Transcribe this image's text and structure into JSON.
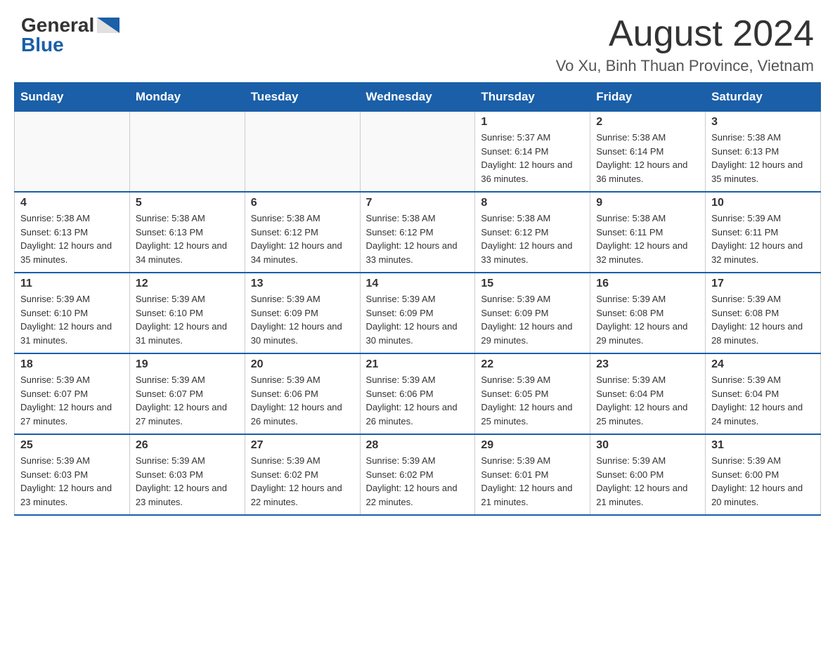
{
  "header": {
    "logo_general": "General",
    "logo_blue": "Blue",
    "title": "August 2024",
    "location": "Vo Xu, Binh Thuan Province, Vietnam"
  },
  "weekdays": [
    "Sunday",
    "Monday",
    "Tuesday",
    "Wednesday",
    "Thursday",
    "Friday",
    "Saturday"
  ],
  "weeks": [
    [
      {
        "day": "",
        "info": ""
      },
      {
        "day": "",
        "info": ""
      },
      {
        "day": "",
        "info": ""
      },
      {
        "day": "",
        "info": ""
      },
      {
        "day": "1",
        "info": "Sunrise: 5:37 AM\nSunset: 6:14 PM\nDaylight: 12 hours and 36 minutes."
      },
      {
        "day": "2",
        "info": "Sunrise: 5:38 AM\nSunset: 6:14 PM\nDaylight: 12 hours and 36 minutes."
      },
      {
        "day": "3",
        "info": "Sunrise: 5:38 AM\nSunset: 6:13 PM\nDaylight: 12 hours and 35 minutes."
      }
    ],
    [
      {
        "day": "4",
        "info": "Sunrise: 5:38 AM\nSunset: 6:13 PM\nDaylight: 12 hours and 35 minutes."
      },
      {
        "day": "5",
        "info": "Sunrise: 5:38 AM\nSunset: 6:13 PM\nDaylight: 12 hours and 34 minutes."
      },
      {
        "day": "6",
        "info": "Sunrise: 5:38 AM\nSunset: 6:12 PM\nDaylight: 12 hours and 34 minutes."
      },
      {
        "day": "7",
        "info": "Sunrise: 5:38 AM\nSunset: 6:12 PM\nDaylight: 12 hours and 33 minutes."
      },
      {
        "day": "8",
        "info": "Sunrise: 5:38 AM\nSunset: 6:12 PM\nDaylight: 12 hours and 33 minutes."
      },
      {
        "day": "9",
        "info": "Sunrise: 5:38 AM\nSunset: 6:11 PM\nDaylight: 12 hours and 32 minutes."
      },
      {
        "day": "10",
        "info": "Sunrise: 5:39 AM\nSunset: 6:11 PM\nDaylight: 12 hours and 32 minutes."
      }
    ],
    [
      {
        "day": "11",
        "info": "Sunrise: 5:39 AM\nSunset: 6:10 PM\nDaylight: 12 hours and 31 minutes."
      },
      {
        "day": "12",
        "info": "Sunrise: 5:39 AM\nSunset: 6:10 PM\nDaylight: 12 hours and 31 minutes."
      },
      {
        "day": "13",
        "info": "Sunrise: 5:39 AM\nSunset: 6:09 PM\nDaylight: 12 hours and 30 minutes."
      },
      {
        "day": "14",
        "info": "Sunrise: 5:39 AM\nSunset: 6:09 PM\nDaylight: 12 hours and 30 minutes."
      },
      {
        "day": "15",
        "info": "Sunrise: 5:39 AM\nSunset: 6:09 PM\nDaylight: 12 hours and 29 minutes."
      },
      {
        "day": "16",
        "info": "Sunrise: 5:39 AM\nSunset: 6:08 PM\nDaylight: 12 hours and 29 minutes."
      },
      {
        "day": "17",
        "info": "Sunrise: 5:39 AM\nSunset: 6:08 PM\nDaylight: 12 hours and 28 minutes."
      }
    ],
    [
      {
        "day": "18",
        "info": "Sunrise: 5:39 AM\nSunset: 6:07 PM\nDaylight: 12 hours and 27 minutes."
      },
      {
        "day": "19",
        "info": "Sunrise: 5:39 AM\nSunset: 6:07 PM\nDaylight: 12 hours and 27 minutes."
      },
      {
        "day": "20",
        "info": "Sunrise: 5:39 AM\nSunset: 6:06 PM\nDaylight: 12 hours and 26 minutes."
      },
      {
        "day": "21",
        "info": "Sunrise: 5:39 AM\nSunset: 6:06 PM\nDaylight: 12 hours and 26 minutes."
      },
      {
        "day": "22",
        "info": "Sunrise: 5:39 AM\nSunset: 6:05 PM\nDaylight: 12 hours and 25 minutes."
      },
      {
        "day": "23",
        "info": "Sunrise: 5:39 AM\nSunset: 6:04 PM\nDaylight: 12 hours and 25 minutes."
      },
      {
        "day": "24",
        "info": "Sunrise: 5:39 AM\nSunset: 6:04 PM\nDaylight: 12 hours and 24 minutes."
      }
    ],
    [
      {
        "day": "25",
        "info": "Sunrise: 5:39 AM\nSunset: 6:03 PM\nDaylight: 12 hours and 23 minutes."
      },
      {
        "day": "26",
        "info": "Sunrise: 5:39 AM\nSunset: 6:03 PM\nDaylight: 12 hours and 23 minutes."
      },
      {
        "day": "27",
        "info": "Sunrise: 5:39 AM\nSunset: 6:02 PM\nDaylight: 12 hours and 22 minutes."
      },
      {
        "day": "28",
        "info": "Sunrise: 5:39 AM\nSunset: 6:02 PM\nDaylight: 12 hours and 22 minutes."
      },
      {
        "day": "29",
        "info": "Sunrise: 5:39 AM\nSunset: 6:01 PM\nDaylight: 12 hours and 21 minutes."
      },
      {
        "day": "30",
        "info": "Sunrise: 5:39 AM\nSunset: 6:00 PM\nDaylight: 12 hours and 21 minutes."
      },
      {
        "day": "31",
        "info": "Sunrise: 5:39 AM\nSunset: 6:00 PM\nDaylight: 12 hours and 20 minutes."
      }
    ]
  ]
}
